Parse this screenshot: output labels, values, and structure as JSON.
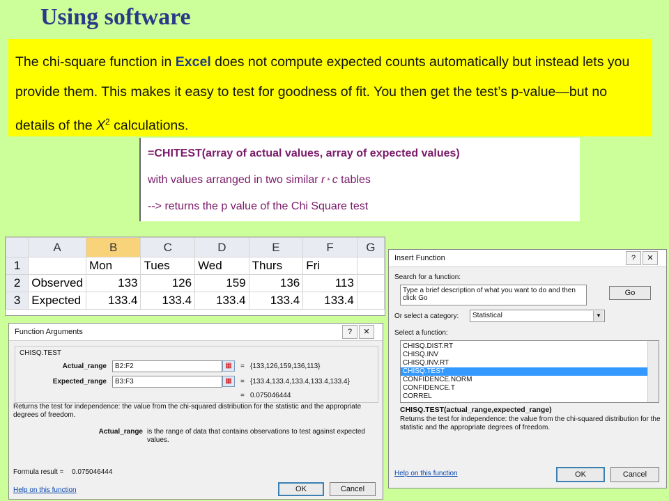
{
  "title": "Using software",
  "intro": {
    "part1": "The chi-square function in ",
    "excel": "Excel",
    "part2": " does not compute expected counts automatically but instead lets you provide them. This makes it easy to test for goodness of fit. You then get the test’s p-value—but no details of the ",
    "x": "X",
    "sup": "2",
    "part3": " calculations."
  },
  "formula": {
    "line1": "=CHITEST(array of actual values, array of expected values)",
    "line2a": "with values arranged in two similar ",
    "line2r": "r",
    "line2star": " * ",
    "line2c": "c",
    "line2b": " tables",
    "line3": "--> returns the p value of the Chi Square test"
  },
  "sheet": {
    "col_headers": [
      "A",
      "B",
      "C",
      "D",
      "E",
      "F",
      "G"
    ],
    "row_headers": [
      "1",
      "2",
      "3"
    ],
    "rows": [
      [
        "",
        "Mon",
        "Tues",
        "Wed",
        "Thurs",
        "Fri"
      ],
      [
        "Observed",
        "133",
        "126",
        "159",
        "136",
        "113"
      ],
      [
        "Expected",
        "133.4",
        "133.4",
        "133.4",
        "133.4",
        "133.4"
      ]
    ]
  },
  "function_args": {
    "title": "Function Arguments",
    "help_q": "?",
    "close_x": "✕",
    "group": "CHISQ.TEST",
    "actual_label": "Actual_range",
    "actual_value": "B2:F2",
    "actual_result": "{133,126,159,136,113}",
    "expected_label": "Expected_range",
    "expected_value": "B3:F3",
    "expected_result": "{133.4,133.4,133.4,133.4,133.4}",
    "equals": "=",
    "result": "0.075046444",
    "description": "Returns the test for independence: the value from the chi-squared distribution for the statistic and the appropriate degrees of freedom.",
    "arg_name": "Actual_range",
    "arg_desc": "is the range of data that contains observations to test against expected values.",
    "formula_result_label": "Formula result =",
    "formula_result_value": "0.075046444",
    "help_link": "Help on this function",
    "ok": "OK",
    "cancel": "Cancel"
  },
  "insert_function": {
    "title": "Insert Function",
    "help_q": "?",
    "close_x": "✕",
    "search_label": "Search for a function:",
    "search_value": "Type a brief description of what you want to do and then click Go",
    "go": "Go",
    "category_label": "Or select a category:",
    "category_value": "Statistical",
    "select_label": "Select a function:",
    "functions": [
      "CHISQ.DIST.RT",
      "CHISQ.INV",
      "CHISQ.INV.RT",
      "CHISQ.TEST",
      "CONFIDENCE.NORM",
      "CONFIDENCE.T",
      "CORREL"
    ],
    "selected_index": 3,
    "signature": "CHISQ.TEST(actual_range,expected_range)",
    "description": "Returns the test for independence: the value from the chi-squared distribution for the statistic and the appropriate degrees of freedom.",
    "help_link": "Help on this function",
    "ok": "OK",
    "cancel": "Cancel"
  },
  "colors": {
    "background": "#ccff99",
    "highlight": "#ffff00",
    "title": "#2b3a87",
    "selection": "#3399ff"
  }
}
